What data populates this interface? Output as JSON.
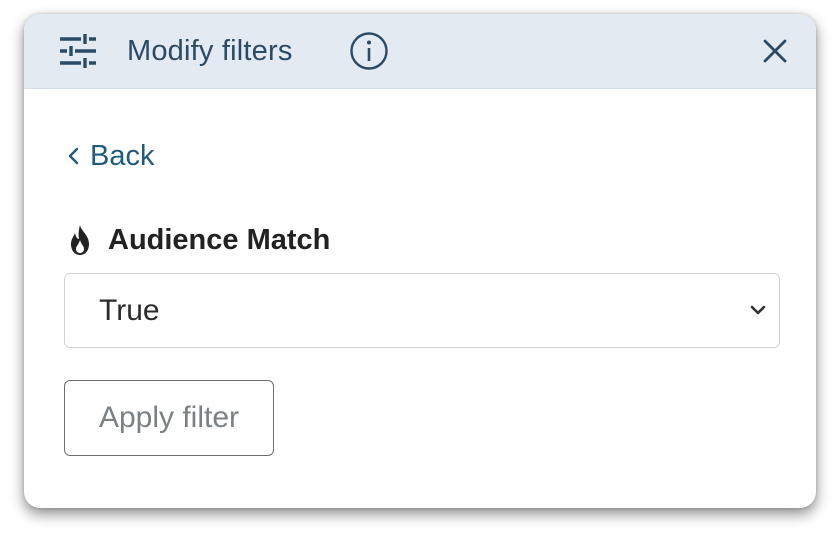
{
  "dialog": {
    "title": "Modify filters",
    "header_icon": "sliders-icon",
    "info_icon": "info-icon",
    "close_icon": "close-icon"
  },
  "back_link": {
    "label": "Back",
    "icon": "chevron-left-icon"
  },
  "filter": {
    "icon": "flame-icon",
    "label": "Audience Match",
    "selected_value": "True",
    "dropdown_icon": "chevron-down-icon"
  },
  "apply_button": {
    "label": "Apply filter"
  },
  "colors": {
    "header_bg": "#e4eaf2",
    "header_text": "#2a4a66",
    "link": "#1f5a7f",
    "button_border": "#6a6f75",
    "button_text": "#7b8085"
  }
}
